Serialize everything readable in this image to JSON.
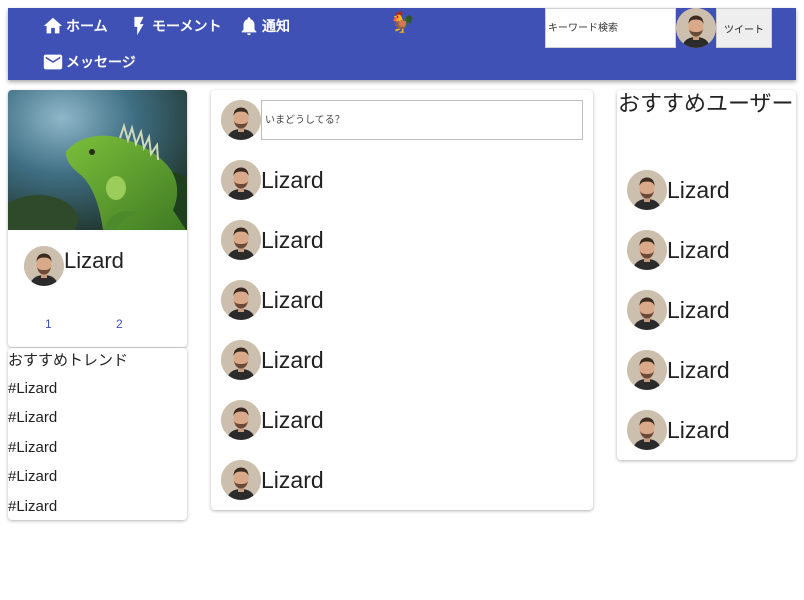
{
  "header": {
    "nav": {
      "home": "ホーム",
      "moment": "モーメント",
      "notifications": "通知",
      "messages": "メッセージ"
    },
    "logo_glyph": "🐓",
    "search_placeholder": "キーワード検索",
    "tweet_button": "ツイート"
  },
  "profile": {
    "name": "Lizard",
    "stat_1": "1",
    "stat_2": "2"
  },
  "trends": {
    "title": "おすすめトレンド",
    "items": [
      "#Lizard",
      "#Lizard",
      "#Lizard",
      "#Lizard",
      "#Lizard"
    ]
  },
  "timeline": {
    "input_placeholder": "いまどうしてる？",
    "posts": [
      "Lizard",
      "Lizard",
      "Lizard",
      "Lizard",
      "Lizard",
      "Lizard"
    ]
  },
  "recommended": {
    "title": "おすすめユーザー",
    "users": [
      "Lizard",
      "Lizard",
      "Lizard",
      "Lizard",
      "Lizard"
    ]
  },
  "colors": {
    "header_bg": "#3f51b5",
    "link": "#3f51b5"
  },
  "icons": {
    "home": "home-icon",
    "moment": "lightning-icon",
    "notifications": "bell-icon",
    "messages": "mail-icon"
  }
}
